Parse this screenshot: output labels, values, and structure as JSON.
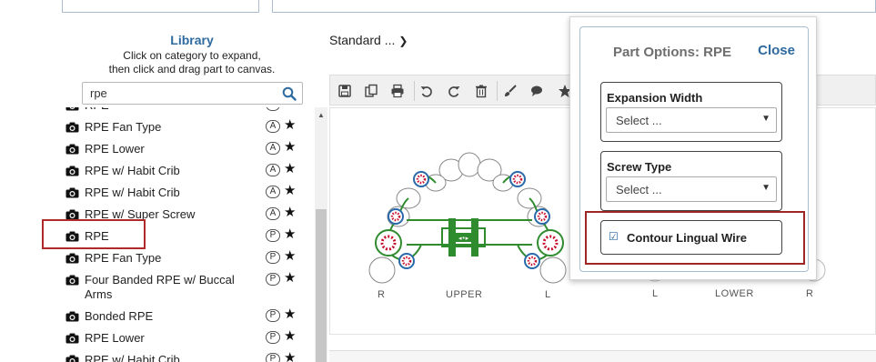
{
  "library": {
    "title": "Library",
    "help_line1": "Click on category to expand,",
    "help_line2": "then click and drag part to canvas.",
    "search_value": "rpe",
    "items": [
      {
        "label": "RPE",
        "badge": "A"
      },
      {
        "label": "RPE Fan Type",
        "badge": "A"
      },
      {
        "label": "RPE Lower",
        "badge": "A"
      },
      {
        "label": "RPE w/ Habit Crib",
        "badge": "A"
      },
      {
        "label": "RPE w/ Habit Crib",
        "badge": "A"
      },
      {
        "label": "RPE w/ Super Screw",
        "badge": "A"
      },
      {
        "label": "RPE",
        "badge": "P"
      },
      {
        "label": "RPE Fan Type",
        "badge": "P"
      },
      {
        "label": "Four Banded RPE w/ Buccal Arms",
        "badge": "P"
      },
      {
        "label": "Bonded RPE",
        "badge": "P"
      },
      {
        "label": "RPE Lower",
        "badge": "P"
      },
      {
        "label": "RPE w/ Habit Crib",
        "badge": "P"
      }
    ]
  },
  "center": {
    "standard_label": "Standard ...",
    "upper_labels": {
      "left": "R",
      "middle": "UPPER",
      "right": "L"
    },
    "lower_labels": {
      "left": "L",
      "middle": "LOWER",
      "right": "R"
    }
  },
  "modal": {
    "title": "Part Options: RPE",
    "close": "Close",
    "expansion_width_label": "Expansion Width",
    "expansion_width_value": "Select ...",
    "screw_type_label": "Screw Type",
    "screw_type_value": "Select ...",
    "contour_label": "Contour Lingual Wire",
    "contour_checked": true
  },
  "colors": {
    "accent": "#2d6aa0",
    "highlight": "#b02a2a",
    "wire": "#2e8b2e",
    "band": "#c8102e"
  }
}
